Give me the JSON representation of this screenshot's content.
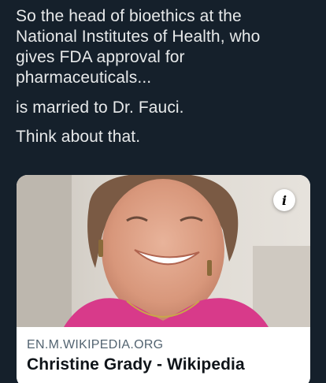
{
  "tweet": {
    "paragraphs": [
      "So the head of bioethics at the\nNational Institutes of Health, who\ngives FDA approval for\npharmaceuticals...",
      "is married to Dr. Fauci.",
      "Think about that."
    ]
  },
  "link_card": {
    "image_icon": "info-icon",
    "info_label": "i",
    "domain": "EN.M.WIKIPEDIA.ORG",
    "title": "Christine Grady - Wikipedia"
  },
  "colors": {
    "background": "#15202b",
    "text": "#e7e9ea",
    "card_domain": "#536471",
    "card_title": "#0f1419"
  }
}
